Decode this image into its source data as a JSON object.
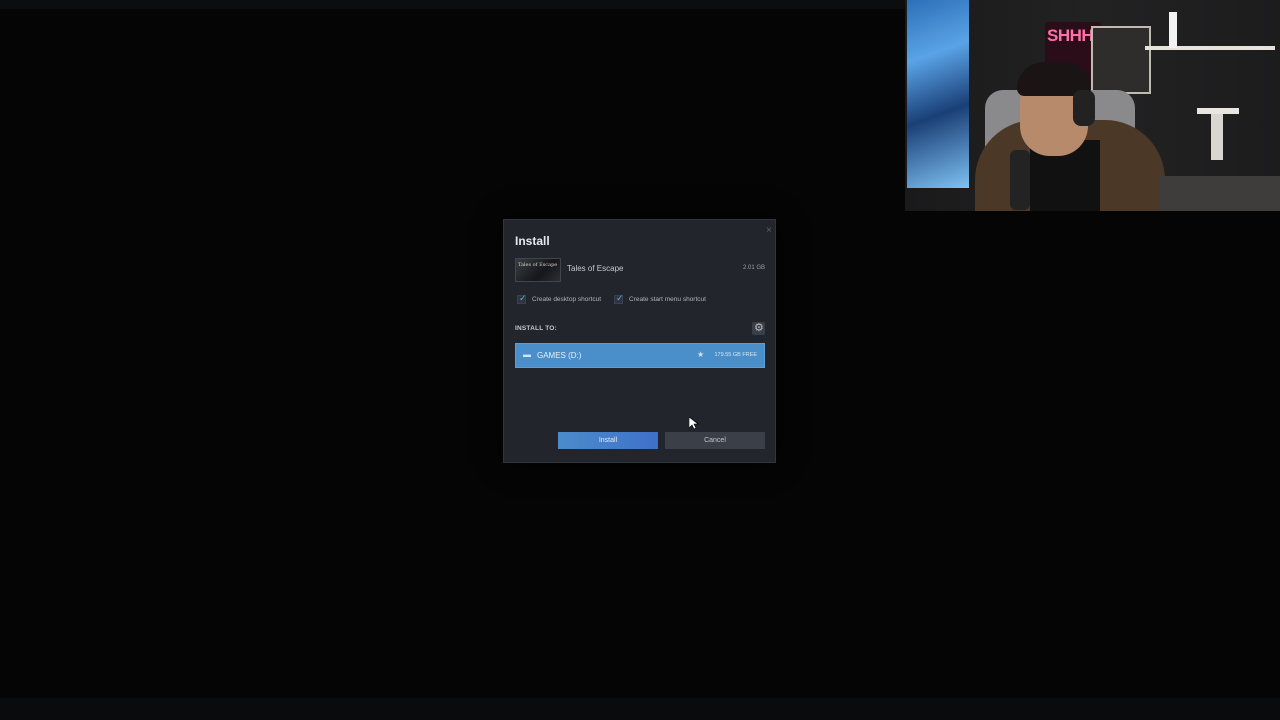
{
  "dialog": {
    "title": "Install",
    "close_glyph": "×",
    "game": {
      "name": "Tales of Escape",
      "size": "2.01 GB",
      "thumbnail_text": "Tales of Escape"
    },
    "options": [
      {
        "label": "Create desktop shortcut",
        "checked": true
      },
      {
        "label": "Create start menu shortcut",
        "checked": true
      }
    ],
    "check_glyph": "✓",
    "install_to_label": "INSTALL TO:",
    "gear_glyph": "⚙",
    "drive": {
      "name": "GAMES (D:)",
      "free": "179.55 GB FREE",
      "icon_glyph": "▬",
      "star_glyph": "★"
    },
    "buttons": {
      "install": "Install",
      "cancel": "Cancel"
    }
  },
  "webcam": {
    "neon_sign": "SHHH!"
  },
  "colors": {
    "dialog_bg": "#22252b",
    "accent_blue": "#4a8fc9",
    "install_button": "#4b8ccb"
  },
  "cursor_glyph": "➤"
}
